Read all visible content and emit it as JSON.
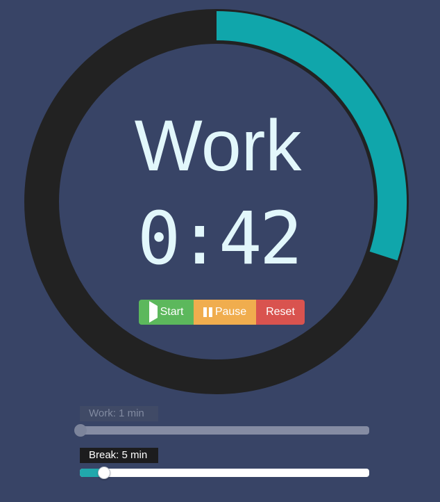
{
  "timer": {
    "mode": "Work",
    "time": "0:42",
    "progress": 0.3
  },
  "controls": {
    "start_label": "Start",
    "pause_label": "Pause",
    "reset_label": "Reset"
  },
  "sliders": {
    "work": {
      "label": "Work: 1 min",
      "value": 1,
      "min": 1,
      "max": 60,
      "disabled": true
    },
    "break": {
      "label": "Break: 5 min",
      "value": 5,
      "min": 1,
      "max": 60,
      "disabled": false
    }
  },
  "colors": {
    "background": "#384466",
    "ring_track": "#222222",
    "ring_progress": "#10a6ab",
    "text": "#e2f7fb",
    "start": "#5cb85c",
    "pause": "#f0ad4e",
    "reset": "#d9534f",
    "slider_fill": "#21a8ac"
  },
  "icons": {
    "start": "play-icon",
    "pause": "pause-icon"
  }
}
